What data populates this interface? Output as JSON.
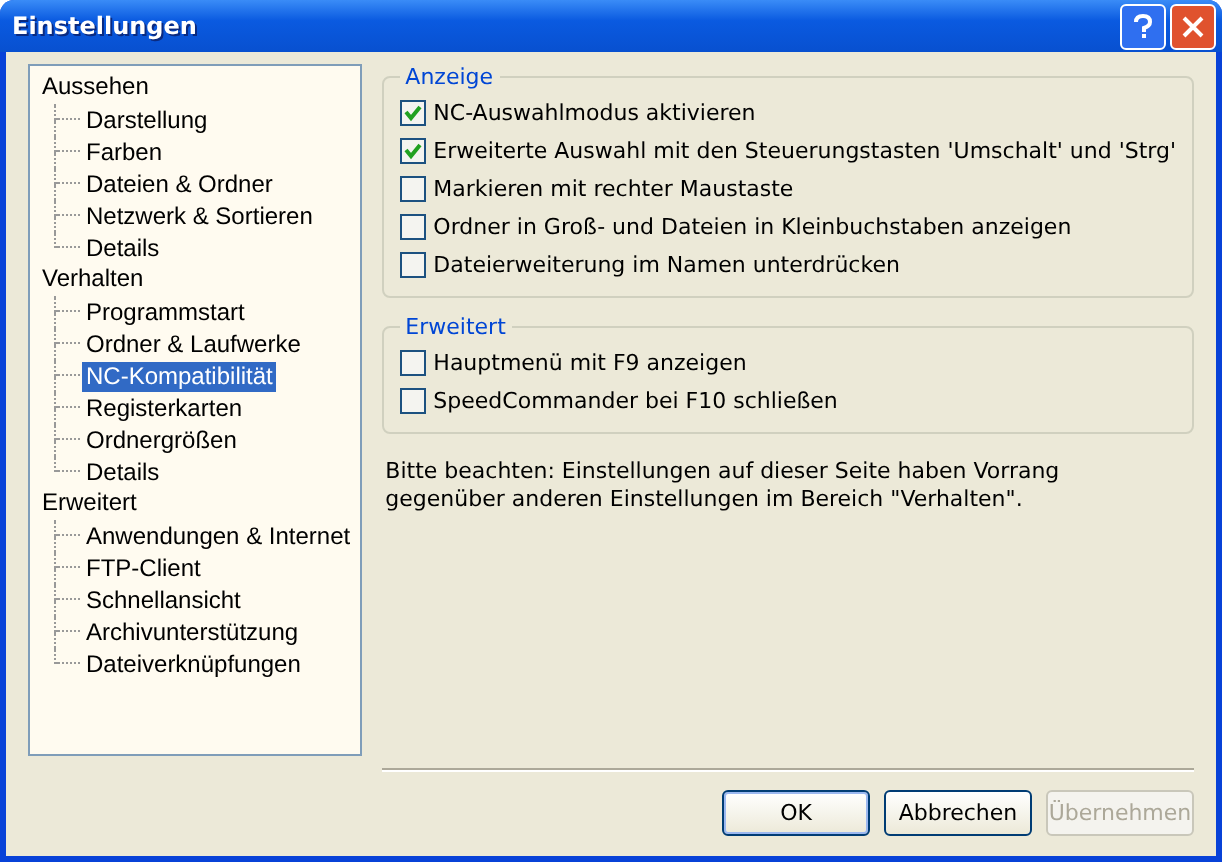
{
  "window": {
    "title": "Einstellungen"
  },
  "tree": [
    {
      "label": "Aussehen",
      "selected": false,
      "children": [
        {
          "label": "Darstellung",
          "selected": false
        },
        {
          "label": "Farben",
          "selected": false
        },
        {
          "label": "Dateien & Ordner",
          "selected": false
        },
        {
          "label": "Netzwerk & Sortieren",
          "selected": false
        },
        {
          "label": "Details",
          "selected": false
        }
      ]
    },
    {
      "label": "Verhalten",
      "selected": false,
      "children": [
        {
          "label": "Programmstart",
          "selected": false
        },
        {
          "label": "Ordner & Laufwerke",
          "selected": false
        },
        {
          "label": "NC-Kompatibilität",
          "selected": true
        },
        {
          "label": "Registerkarten",
          "selected": false
        },
        {
          "label": "Ordnergrößen",
          "selected": false
        },
        {
          "label": "Details",
          "selected": false
        }
      ]
    },
    {
      "label": "Erweitert",
      "selected": false,
      "children": [
        {
          "label": "Anwendungen & Internet",
          "selected": false
        },
        {
          "label": "FTP-Client",
          "selected": false
        },
        {
          "label": "Schnellansicht",
          "selected": false
        },
        {
          "label": "Archivunterstützung",
          "selected": false
        },
        {
          "label": "Dateiverknüpfungen",
          "selected": false
        }
      ]
    }
  ],
  "groups": [
    {
      "title": "Anzeige",
      "options": [
        {
          "label": "NC-Auswahlmodus aktivieren",
          "checked": true
        },
        {
          "label": "Erweiterte Auswahl mit den Steuerungstasten 'Umschalt' und 'Strg'",
          "checked": true
        },
        {
          "label": "Markieren mit rechter Maustaste",
          "checked": false
        },
        {
          "label": "Ordner in Groß- und Dateien in Kleinbuchstaben anzeigen",
          "checked": false
        },
        {
          "label": "Dateierweiterung im Namen unterdrücken",
          "checked": false
        }
      ]
    },
    {
      "title": "Erweitert",
      "options": [
        {
          "label": "Hauptmenü mit F9 anzeigen",
          "checked": false
        },
        {
          "label": "SpeedCommander bei F10 schließen",
          "checked": false
        }
      ]
    }
  ],
  "note": "Bitte beachten: Einstellungen auf dieser Seite haben Vorrang gegenüber anderen Einstellungen im Bereich \"Verhalten\".",
  "buttons": [
    {
      "label": "OK",
      "disabled": false
    },
    {
      "label": "Abbrechen",
      "disabled": false
    },
    {
      "label": "Übernehmen",
      "disabled": true
    }
  ]
}
